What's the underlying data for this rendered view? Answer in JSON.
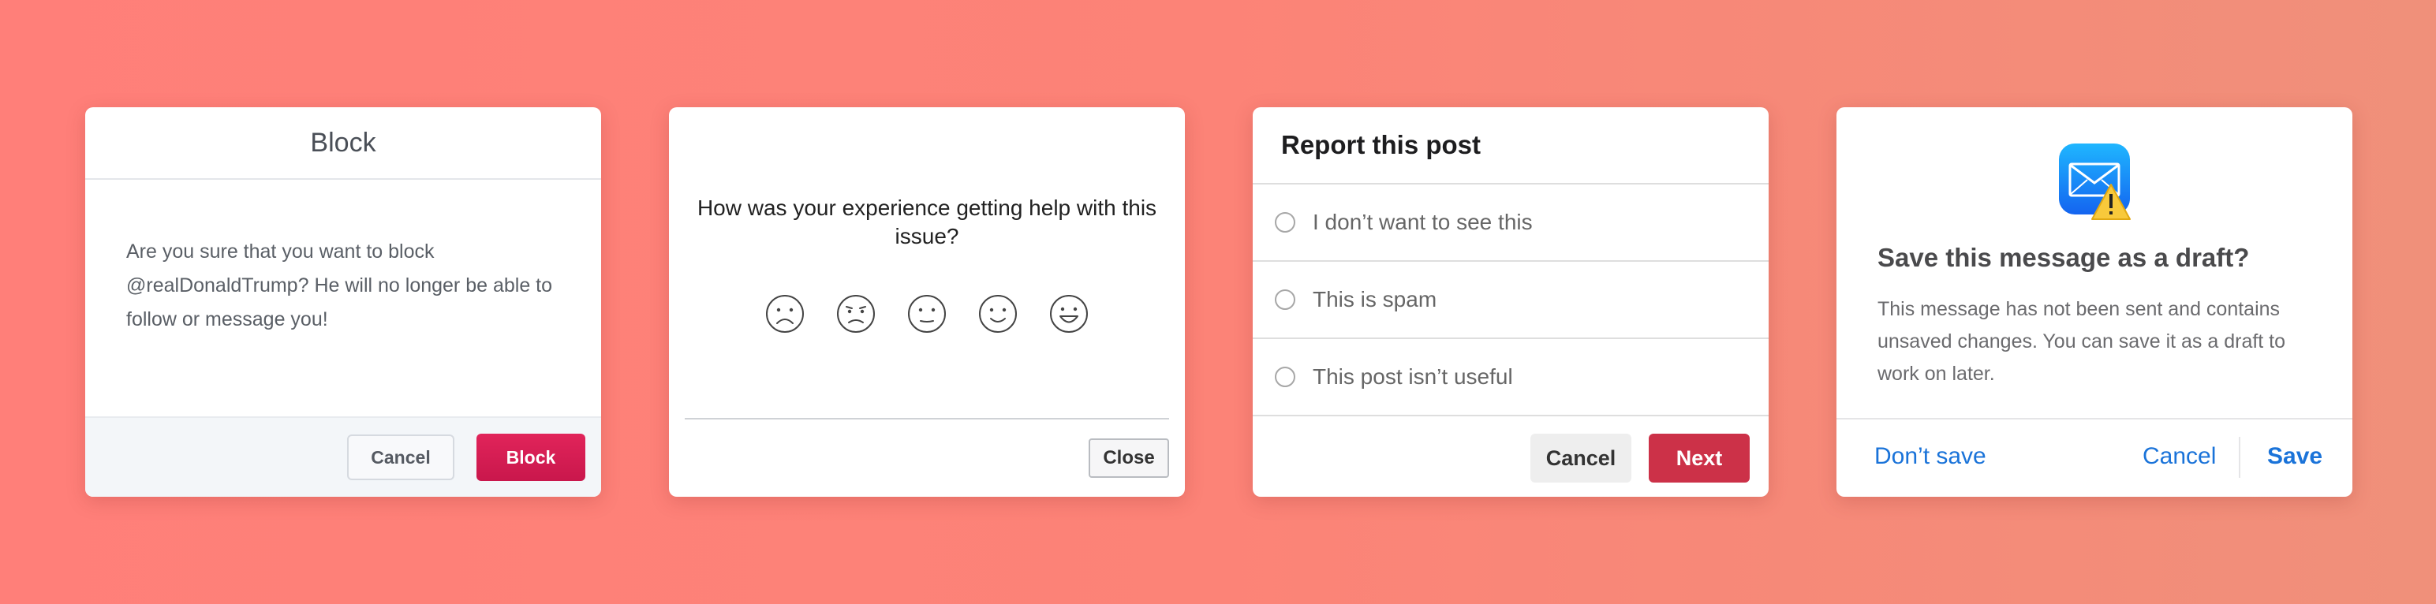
{
  "block_dialog": {
    "title": "Block",
    "message": "Are you sure that you want to block @realDonaldTrump? He will no longer be able to follow or message you!",
    "cancel_label": "Cancel",
    "confirm_label": "Block",
    "confirm_color": "#d71f55"
  },
  "feedback_dialog": {
    "question": "How was your experience getting help with this issue?",
    "faces": [
      "very-sad-face-icon",
      "sad-face-icon",
      "neutral-face-icon",
      "happy-face-icon",
      "very-happy-face-icon"
    ],
    "close_label": "Close"
  },
  "report_dialog": {
    "title": "Report this post",
    "options": [
      {
        "label": "I don’t want to see this"
      },
      {
        "label": "This is spam"
      },
      {
        "label": "This post isn’t useful"
      }
    ],
    "cancel_label": "Cancel",
    "next_label": "Next",
    "next_color": "#cc3148"
  },
  "draft_dialog": {
    "icon": "mail-warning-icon",
    "title": "Save this message as a draft?",
    "message": "This message has not been sent and contains unsaved changes. You can save it as a draft to work on later.",
    "dont_save_label": "Don’t save",
    "cancel_label": "Cancel",
    "save_label": "Save",
    "link_color": "#1a73d9"
  }
}
